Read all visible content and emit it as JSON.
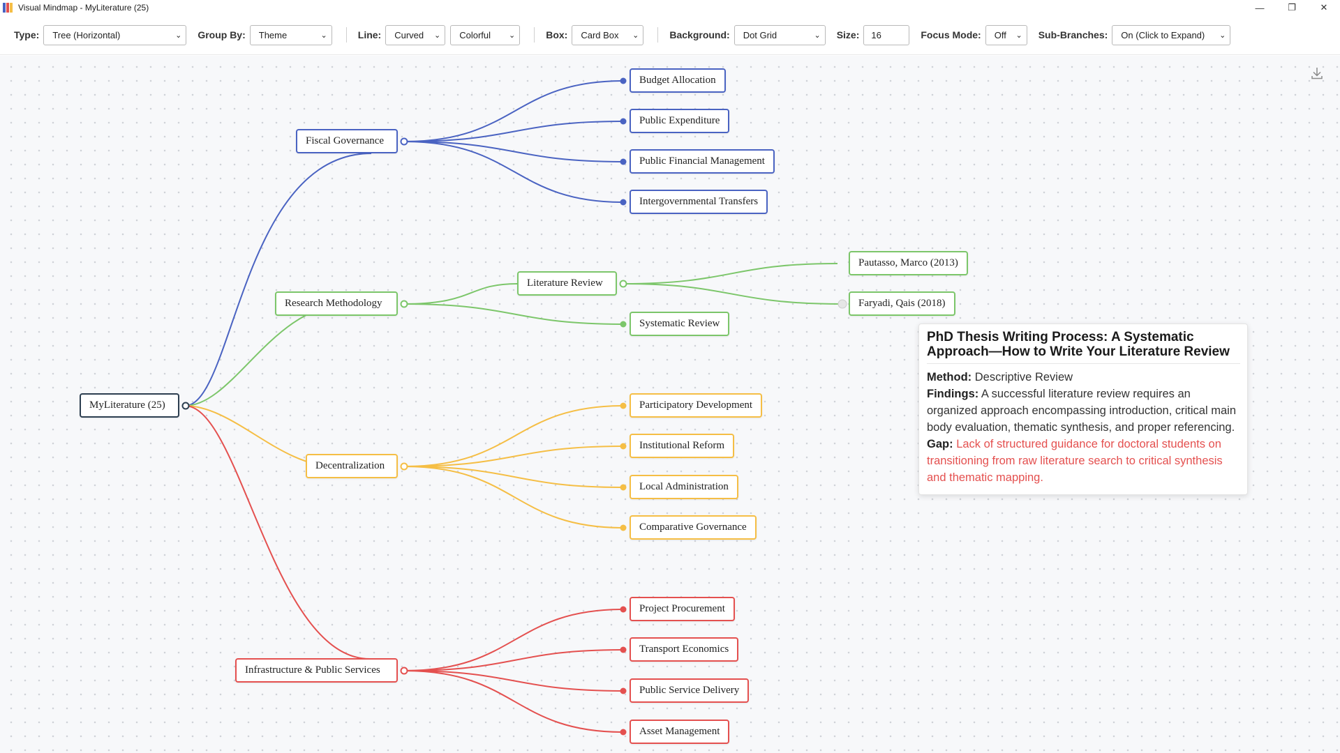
{
  "window": {
    "title": "Visual Mindmap - MyLiterature (25)",
    "controls": {
      "minimize": "—",
      "maximize": "❐",
      "close": "✕"
    }
  },
  "toolbar": {
    "type": {
      "label": "Type:",
      "value": "Tree (Horizontal)"
    },
    "group_by": {
      "label": "Group By:",
      "value": "Theme"
    },
    "line": {
      "label": "Line:",
      "style": "Curved",
      "color": "Colorful"
    },
    "box": {
      "label": "Box:",
      "value": "Card Box"
    },
    "background": {
      "label": "Background:",
      "value": "Dot Grid"
    },
    "size": {
      "label": "Size:",
      "value": "16"
    },
    "focus_mode": {
      "label": "Focus Mode:",
      "value": "Off"
    },
    "sub_branches": {
      "label": "Sub-Branches:",
      "value": "On (Click to Expand)"
    }
  },
  "colors": {
    "blue": "#4a63c2",
    "green": "#7cc66a",
    "yellow": "#f5be45",
    "red": "#e4504f",
    "root": "#2c3e50"
  },
  "mindmap": {
    "root": "MyLiterature (25)",
    "branches": [
      {
        "label": "Fiscal Governance",
        "color": "blue",
        "children": [
          "Budget Allocation",
          "Public Expenditure",
          "Public Financial Management",
          "Intergovernmental Transfers"
        ]
      },
      {
        "label": "Research Methodology",
        "color": "green",
        "children": [
          "Literature Review",
          "Systematic Review"
        ],
        "sub": {
          "label": "Literature Review",
          "children": [
            "Pautasso, Marco (2013)",
            "Faryadi, Qais (2018)"
          ]
        }
      },
      {
        "label": "Decentralization",
        "color": "yellow",
        "children": [
          "Participatory Development",
          "Institutional Reform",
          "Local Administration",
          "Comparative Governance"
        ]
      },
      {
        "label": "Infrastructure & Public Services",
        "color": "red",
        "children": [
          "Project Procurement",
          "Transport Economics",
          "Public Service Delivery",
          "Asset Management"
        ]
      }
    ]
  },
  "tooltip": {
    "title": "PhD Thesis Writing Process: A Systematic Approach—How to Write Your Literature Review",
    "method_label": "Method:",
    "method": "Descriptive Review",
    "findings_label": "Findings:",
    "findings": "A successful literature review requires an organized approach encompassing introduction, critical main body evaluation, thematic synthesis, and proper referencing.",
    "gap_label": "Gap:",
    "gap": "Lack of structured guidance for doctoral students on transitioning from raw literature search to critical synthesis and thematic mapping."
  },
  "icons": {
    "download": "download-icon",
    "app": "app-icon"
  }
}
